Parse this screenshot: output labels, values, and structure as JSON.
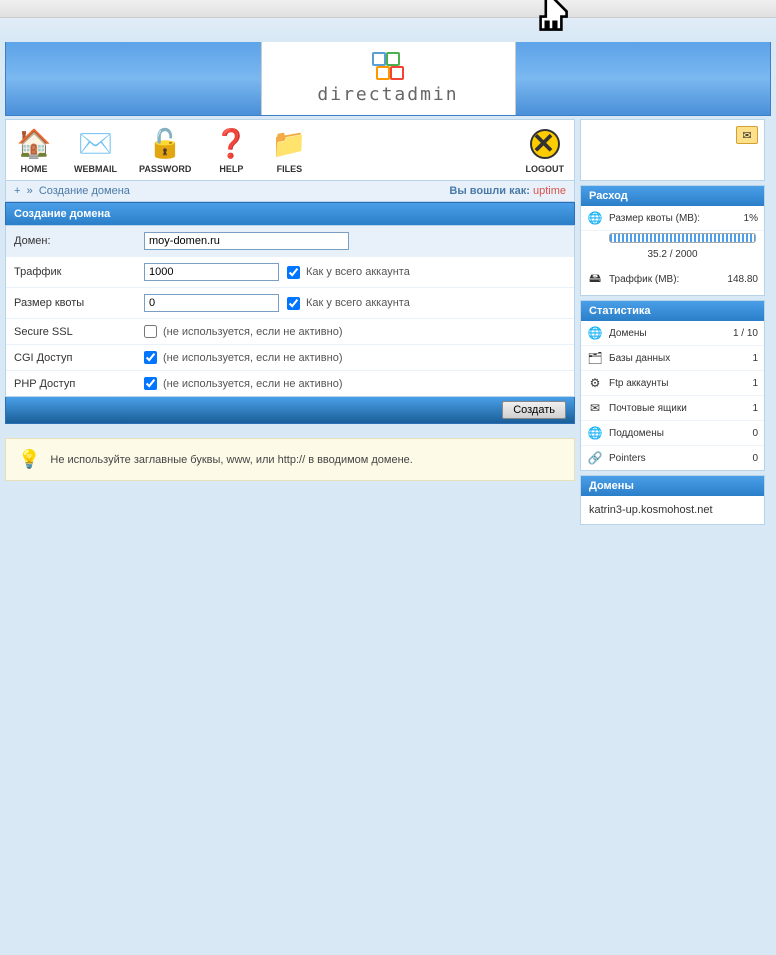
{
  "header": {
    "brand": "directadmin"
  },
  "toolbar": {
    "home": "HOME",
    "webmail": "WEBMAIL",
    "password": "PASSWORD",
    "help": "HELP",
    "files": "FILES",
    "logout": "LOGOUT"
  },
  "breadcrumb": {
    "plus": "+",
    "raquo": "»",
    "page": "Создание домена",
    "logged_as_label": "Вы вошли как:",
    "user": "uptime"
  },
  "form": {
    "title": "Создание домена",
    "rows": {
      "domain": {
        "label": "Домен:",
        "value": "moy-domen.ru"
      },
      "traffic": {
        "label": "Траффик",
        "value": "1000",
        "cb_label": "Как у всего аккаунта"
      },
      "quota": {
        "label": "Размер квоты",
        "value": "0",
        "cb_label": "Как у всего аккаунта"
      },
      "ssl": {
        "label": "Secure SSL",
        "note": "(не используется, если не активно)"
      },
      "cgi": {
        "label": "CGI Доступ",
        "note": "(не используется, если не активно)"
      },
      "php": {
        "label": "PHP Доступ",
        "note": "(не используется, если не активно)"
      }
    },
    "submit": "Создать"
  },
  "hint": "Не используйте заглавные буквы, www, или http:// в вводимом домене.",
  "side": {
    "usage": {
      "title": "Расход",
      "quota_label": "Размер квоты (МВ):",
      "quota_pct": "1%",
      "quota_text": "35.2 / 2000",
      "traffic_label": "Траффик (МВ):",
      "traffic_val": "148.80"
    },
    "stats": {
      "title": "Статистика",
      "rows": [
        {
          "icon": "🌐",
          "label": "Домены",
          "val": "1 / 10"
        },
        {
          "icon": "🗂",
          "label": "Базы данных",
          "val": "1"
        },
        {
          "icon": "⚙",
          "label": "Ftp аккаунты",
          "val": "1"
        },
        {
          "icon": "✉",
          "label": "Почтовые ящики",
          "val": "1"
        },
        {
          "icon": "🌐",
          "label": "Поддомены",
          "val": "0"
        },
        {
          "icon": "🔗",
          "label": "Pointers",
          "val": "0"
        }
      ]
    },
    "domains": {
      "title": "Домены",
      "item": "katrin3-up.kosmohost.net"
    }
  }
}
